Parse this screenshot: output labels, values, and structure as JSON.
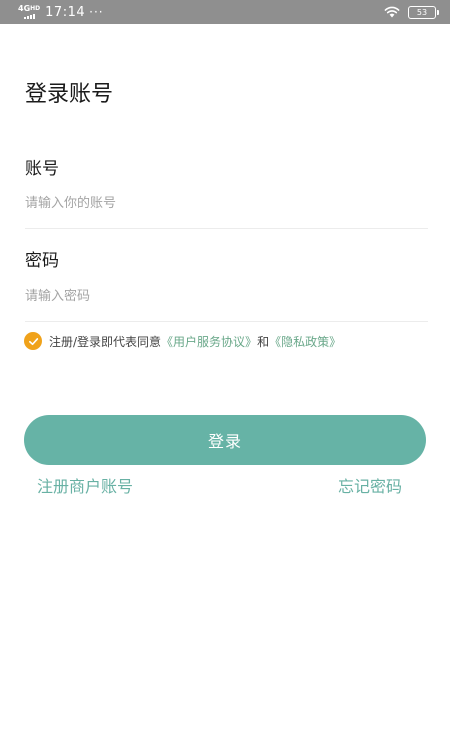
{
  "status_bar": {
    "network": "4G",
    "network_sup": "HD",
    "time": "17:14",
    "dots": "···",
    "battery": "53"
  },
  "page": {
    "title": "登录账号"
  },
  "account": {
    "label": "账号",
    "placeholder": "请输入你的账号"
  },
  "password": {
    "label": "密码",
    "placeholder": "请输入密码"
  },
  "agreement": {
    "checked": true,
    "prefix": "注册/登录即代表同意",
    "terms_link": "《用户服务协议》",
    "conjunction": "和",
    "privacy_link": "《隐私政策》"
  },
  "login_button": {
    "label": "登录"
  },
  "links": {
    "register": "注册商户账号",
    "forgot": "忘记密码"
  },
  "colors": {
    "primary": "#66b3a6",
    "checkbox": "#f0a21a",
    "link": "#6aa88a",
    "status_bar": "#8f8f8f"
  }
}
